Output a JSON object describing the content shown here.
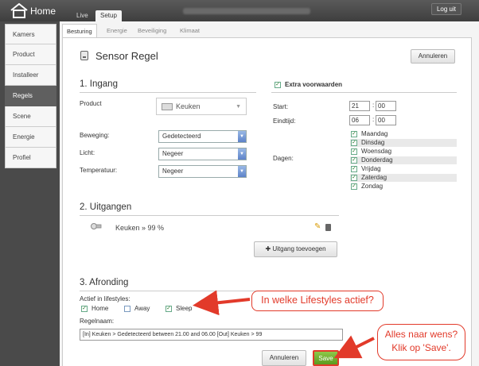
{
  "header": {
    "app_title": "Home",
    "tabs": [
      {
        "label": "Live"
      },
      {
        "label": "Setup"
      }
    ],
    "logout_label": "Log uit"
  },
  "sidebar": {
    "items": [
      {
        "label": "Kamers"
      },
      {
        "label": "Product"
      },
      {
        "label": "Installeer"
      },
      {
        "label": "Regels"
      },
      {
        "label": "Scene"
      },
      {
        "label": "Energie"
      },
      {
        "label": "Profiel"
      }
    ],
    "active": "Regels"
  },
  "subtabs": [
    {
      "label": "Besturing"
    },
    {
      "label": "Energie"
    },
    {
      "label": "Beveiliging"
    },
    {
      "label": "Klimaat"
    }
  ],
  "page": {
    "title": "Sensor Regel",
    "cancel_label": "Annuleren"
  },
  "ingang": {
    "title": "1. Ingang",
    "product_label": "Product",
    "product_value": "Keuken",
    "beweging_label": "Beweging:",
    "beweging_value": "Gedetecteerd",
    "licht_label": "Licht:",
    "licht_value": "Negeer",
    "temperatuur_label": "Temperatuur:",
    "temperatuur_value": "Negeer"
  },
  "extra": {
    "label": "Extra voorwaarden",
    "start_label": "Start:",
    "start_hour": "21",
    "start_min": "00",
    "end_label": "Eindtijd:",
    "end_hour": "06",
    "end_min": "00",
    "dagen_label": "Dagen:",
    "days": [
      {
        "label": "Maandag"
      },
      {
        "label": "Dinsdag"
      },
      {
        "label": "Woensdag"
      },
      {
        "label": "Donderdag"
      },
      {
        "label": "Vrijdag"
      },
      {
        "label": "Zaterdag"
      },
      {
        "label": "Zondag"
      }
    ]
  },
  "uitgangen": {
    "title": "2. Uitgangen",
    "output_text": "Keuken » 99 %",
    "add_label": "Uitgang toevoegen"
  },
  "afronding": {
    "title": "3. Afronding",
    "lifestyles_label": "Actief in lifestyles:",
    "lifestyles": [
      {
        "label": "Home"
      },
      {
        "label": "Away"
      },
      {
        "label": "Sleep"
      }
    ],
    "regelnaam_label": "Regelnaam:",
    "regelnaam_value": "[In] Keuken > Gedetecteerd between 21.00 and 06.00 [Out] Keuken > 99",
    "cancel_label": "Annuleren",
    "save_label": "Save"
  },
  "callouts": {
    "lifestyles_text": "In welke Lifestyles actief?",
    "save_line1": "Alles naar wens?",
    "save_line2": "Klik op 'Save'."
  },
  "icons": {
    "logo": "house-icon",
    "product": "device-icon",
    "output": "bulb-icon",
    "edit": "pencil-icon",
    "delete": "trash-icon"
  },
  "colors": {
    "callout": "#e23a2a",
    "save_button": "#6aab2a",
    "active_sidebar": "#5f5f5f",
    "checkbox_check": "#2a7a2a"
  }
}
